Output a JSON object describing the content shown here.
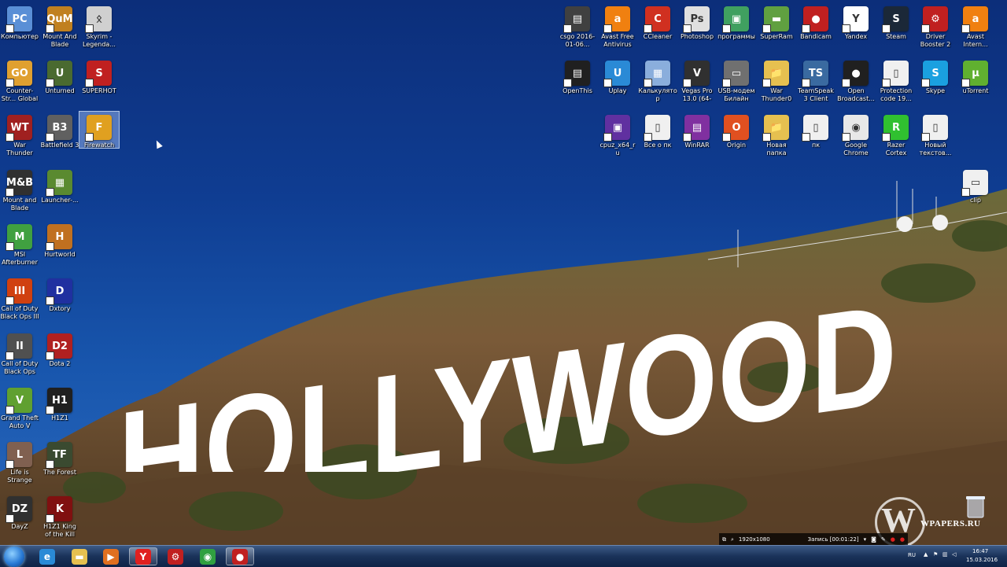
{
  "left_icons": [
    {
      "label": "Компьютер",
      "glyph": "PC",
      "color": "#5a8fd6"
    },
    {
      "label": "Mount And Blade Orwe...",
      "glyph": "QuM",
      "color": "#c08020"
    },
    {
      "label": "Skyrim - Legenda...",
      "glyph": "ᛟ",
      "color": "#d0d0d0"
    },
    {
      "label": "Counter-Str... Global Offe...",
      "glyph": "GO",
      "color": "#e0a030"
    },
    {
      "label": "Unturned",
      "glyph": "U",
      "color": "#4a6a30"
    },
    {
      "label": "SUPERHOT",
      "glyph": "S",
      "color": "#c02020"
    },
    {
      "label": "War Thunder",
      "glyph": "WT",
      "color": "#a02020"
    },
    {
      "label": "Battlefield 3",
      "glyph": "B3",
      "color": "#606060"
    },
    {
      "label": "Firewatch",
      "glyph": "F",
      "color": "#e0a020"
    },
    {
      "label": "Mount and Blade",
      "glyph": "M&B",
      "color": "#303030"
    },
    {
      "label": "Launcher-...",
      "glyph": "▦",
      "color": "#5a8a30"
    },
    {
      "label": "MSI Afterburner",
      "glyph": "M",
      "color": "#40a040"
    },
    {
      "label": "Hurtworld",
      "glyph": "H",
      "color": "#c07020"
    },
    {
      "label": "Call of Duty Black Ops III",
      "glyph": "III",
      "color": "#d04010"
    },
    {
      "label": "Dxtory",
      "glyph": "D",
      "color": "#2030a0"
    },
    {
      "label": "Call of Duty Black Ops L...",
      "glyph": "II",
      "color": "#505050"
    },
    {
      "label": "Dota 2",
      "glyph": "D2",
      "color": "#b02020"
    },
    {
      "label": "Grand Theft Auto V",
      "glyph": "V",
      "color": "#60a030"
    },
    {
      "label": "H1Z1",
      "glyph": "H1",
      "color": "#202020"
    },
    {
      "label": "Life is Strange",
      "glyph": "L",
      "color": "#806050"
    },
    {
      "label": "The Forest",
      "glyph": "TF",
      "color": "#3a4a30"
    },
    {
      "label": "DayZ",
      "glyph": "DZ",
      "color": "#303030"
    },
    {
      "label": "H1Z1 King of the Kill",
      "glyph": "K",
      "color": "#801010"
    }
  ],
  "top_right_icons": [
    {
      "label": "csgo 2016-01-06...",
      "glyph": "▤",
      "color": "#404040"
    },
    {
      "label": "Avast Free Antivirus",
      "glyph": "a",
      "color": "#f08010"
    },
    {
      "label": "CCleaner",
      "glyph": "C",
      "color": "#d03020"
    },
    {
      "label": "Photoshop",
      "glyph": "Ps",
      "color": "#e0e0e0"
    },
    {
      "label": "программы",
      "glyph": "▣",
      "color": "#40a060"
    },
    {
      "label": "SuperRam",
      "glyph": "▬",
      "color": "#60a040"
    },
    {
      "label": "Bandicam",
      "glyph": "●",
      "color": "#c02020"
    },
    {
      "label": "Yandex",
      "glyph": "Y",
      "color": "#ffffff"
    },
    {
      "label": "Steam",
      "glyph": "S",
      "color": "#1b2838"
    },
    {
      "label": "Driver Booster 2",
      "glyph": "⚙",
      "color": "#c02020"
    },
    {
      "label": "Avast Intern...",
      "glyph": "a",
      "color": "#f08010"
    },
    {
      "label": "OpenThis",
      "glyph": "▤",
      "color": "#202020"
    },
    {
      "label": "Uplay",
      "glyph": "U",
      "color": "#2a8ad6"
    },
    {
      "label": "Калькулятор",
      "glyph": "▦",
      "color": "#8aaedc"
    },
    {
      "label": "Vegas Pro 13.0 (64-bit)",
      "glyph": "V",
      "color": "#303030"
    },
    {
      "label": "USB-модем Билайн",
      "glyph": "▭",
      "color": "#707070"
    },
    {
      "label": "War Thunder0",
      "glyph": "📁",
      "color": "#e6c050"
    },
    {
      "label": "TeamSpeak 3 Client",
      "glyph": "TS",
      "color": "#3a6aa0"
    },
    {
      "label": "Open Broadcast...",
      "glyph": "●",
      "color": "#202020"
    },
    {
      "label": "Protection code 19...",
      "glyph": "▯",
      "color": "#f0f0f0"
    },
    {
      "label": "Skype",
      "glyph": "S",
      "color": "#1aa0e0"
    },
    {
      "label": "uTorrent",
      "glyph": "µ",
      "color": "#60b030"
    },
    {
      "label": "cpuz_x64_ru",
      "glyph": "▣",
      "color": "#6030a0"
    },
    {
      "label": "Все о пк",
      "glyph": "▯",
      "color": "#f0f0f0"
    },
    {
      "label": "WinRAR",
      "glyph": "▤",
      "color": "#8030a0"
    },
    {
      "label": "Origin",
      "glyph": "O",
      "color": "#e05020"
    },
    {
      "label": "Новая папка",
      "glyph": "📁",
      "color": "#e6c050"
    },
    {
      "label": "пк",
      "glyph": "▯",
      "color": "#f0f0f0"
    },
    {
      "label": "Google Chrome",
      "glyph": "◉",
      "color": "#e8e8e8"
    },
    {
      "label": "Razer Cortex",
      "glyph": "R",
      "color": "#30c030"
    },
    {
      "label": "Новый текстов...",
      "glyph": "▯",
      "color": "#f0f0f0"
    },
    {
      "label": "clip",
      "glyph": "▭",
      "color": "#f0f0f0"
    }
  ],
  "hollywood_sign": "HOLLYWOOD",
  "watermark": {
    "letter": "W",
    "text": "WPAPERS.RU"
  },
  "recorder": {
    "resolution": "1920x1080",
    "status": "Запись [00:01:22]"
  },
  "taskbar": {
    "apps": [
      {
        "name": "ie-icon",
        "glyph": "e",
        "color": "#2a8ad6"
      },
      {
        "name": "explorer-icon",
        "glyph": "▬",
        "color": "#e6c050"
      },
      {
        "name": "media-player-icon",
        "glyph": "▶",
        "color": "#e07020"
      },
      {
        "name": "yandex-icon",
        "glyph": "Y",
        "color": "#e02020",
        "active": true
      },
      {
        "name": "driver-booster-icon",
        "glyph": "⚙",
        "color": "#c02020"
      },
      {
        "name": "chrome-icon",
        "glyph": "◉",
        "color": "#30a040"
      },
      {
        "name": "bandicam-icon",
        "glyph": "●",
        "color": "#c02020",
        "active": true
      }
    ],
    "language": "RU",
    "time": "16:47",
    "date": "15.03.2016"
  }
}
